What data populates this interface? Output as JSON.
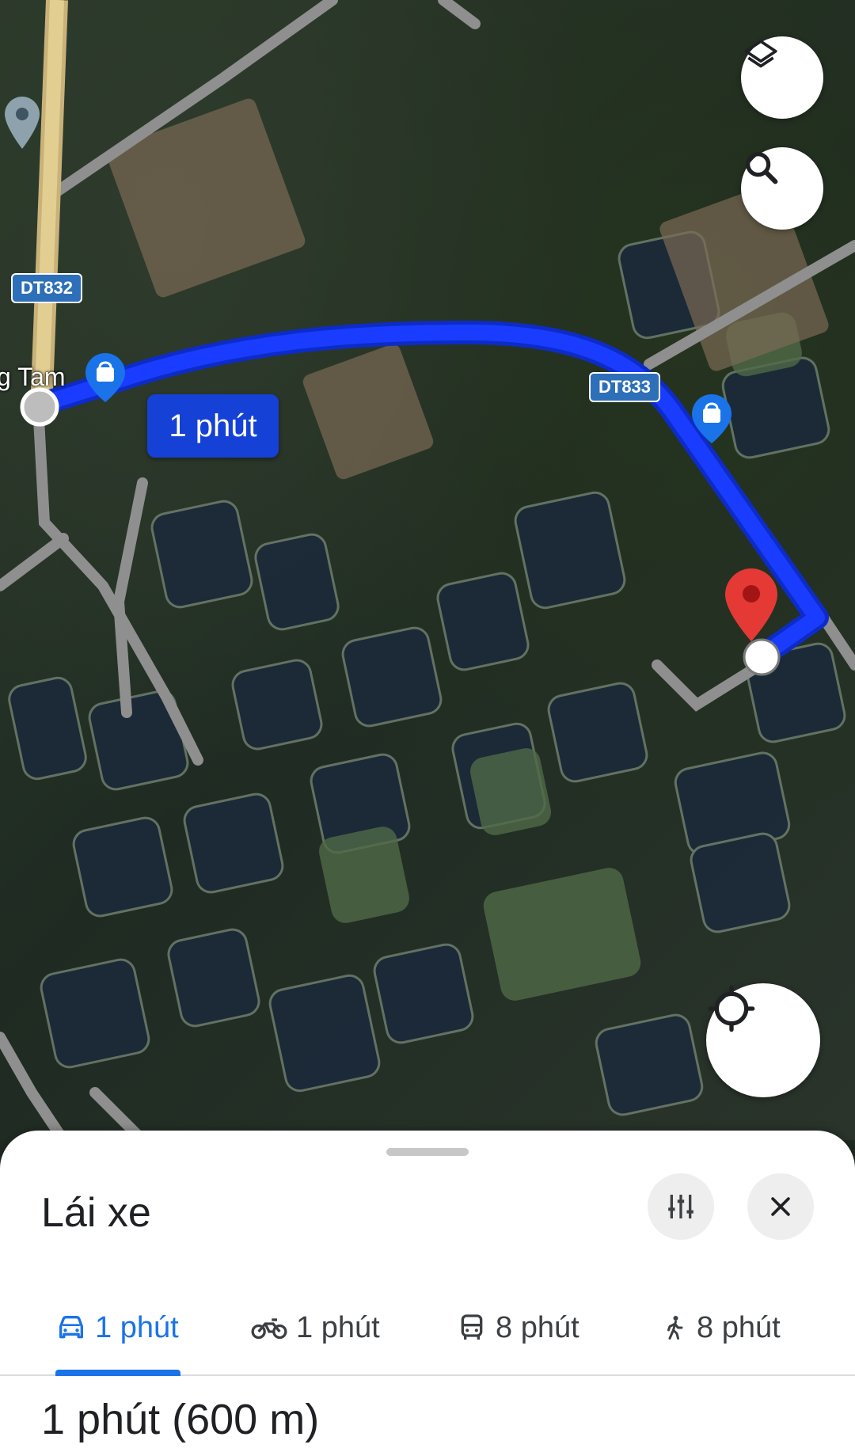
{
  "map": {
    "road_shields": [
      "DT832",
      "DT833"
    ],
    "place_label": "g Tam",
    "route_time_label": "1 phút",
    "colors": {
      "route": "#1a3cff",
      "label_bg": "#1541d6",
      "destination_pin": "#e53935"
    }
  },
  "controls": {
    "layers_icon": "layers-icon",
    "search_icon": "search-icon",
    "location_icon": "my-location-icon"
  },
  "sheet": {
    "title": "Lái xe",
    "tabs": [
      {
        "mode": "car",
        "label": "1 phút",
        "active": true
      },
      {
        "mode": "motorbike",
        "label": "1 phút",
        "active": false
      },
      {
        "mode": "transit",
        "label": "8 phút",
        "active": false
      },
      {
        "mode": "walk",
        "label": "8 phút",
        "active": false
      }
    ],
    "summary": "1 phút (600 m)"
  }
}
